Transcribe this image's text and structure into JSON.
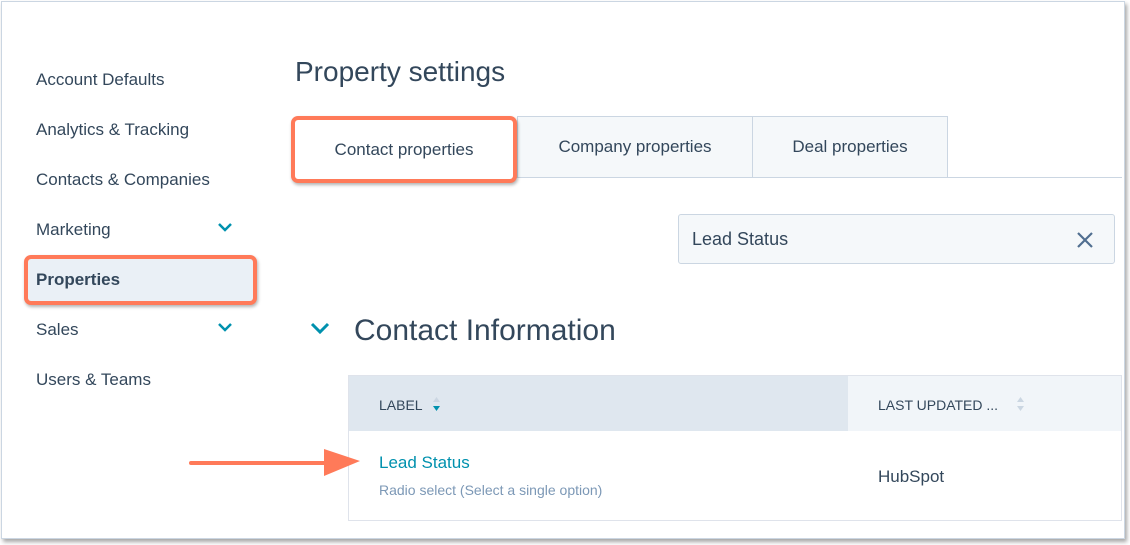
{
  "sidebar": {
    "items": [
      {
        "label": "Account Defaults"
      },
      {
        "label": "Analytics & Tracking"
      },
      {
        "label": "Contacts & Companies"
      },
      {
        "label": "Marketing",
        "expandable": true
      },
      {
        "label": "Properties",
        "selected": true
      },
      {
        "label": "Sales",
        "expandable": true
      },
      {
        "label": "Users & Teams"
      }
    ]
  },
  "page": {
    "title": "Property settings"
  },
  "tabs": [
    {
      "label": "Contact properties",
      "active": true
    },
    {
      "label": "Company properties"
    },
    {
      "label": "Deal properties"
    }
  ],
  "search": {
    "value": "Lead Status",
    "clear_icon": "close-icon"
  },
  "section": {
    "title": "Contact Information"
  },
  "table": {
    "columns": [
      "LABEL",
      "LAST UPDATED ..."
    ],
    "rows": [
      {
        "label": "Lead Status",
        "type": "Radio select (Select a single option)",
        "last_updated": "HubSpot"
      }
    ]
  },
  "colors": {
    "accent": "#0091ae",
    "highlight": "#ff7a59",
    "text": "#33475b"
  }
}
